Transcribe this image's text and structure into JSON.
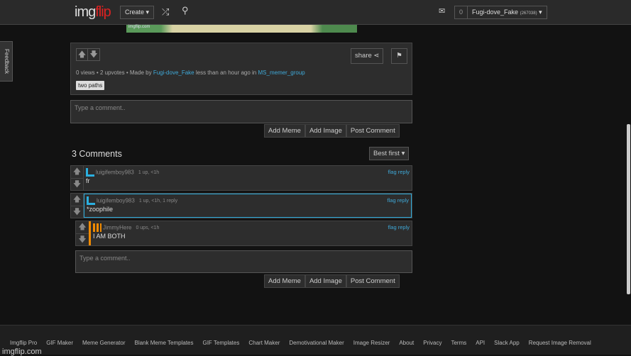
{
  "header": {
    "logo_a": "img",
    "logo_b": "flip",
    "create": "Create ▾",
    "shuffle_icon": "shuffle-icon",
    "search_icon": "search-icon",
    "mail_icon": "mail-icon",
    "notif_count": "0",
    "username": "Fugi-dove_Fake",
    "points": "(267038)",
    "caret": "▾"
  },
  "meme": {
    "watermark": "imgflip.com"
  },
  "feedback": "Feedback",
  "post": {
    "share": "share",
    "views": "0 views",
    "upvotes": "2 upvotes",
    "made_by": "Made by",
    "author": "Fugi-dove_Fake",
    "time": "less than an hour ago in",
    "group": "MS_memer_group",
    "tag": "two paths"
  },
  "comment_form": {
    "placeholder": "Type a comment..",
    "add_meme": "Add Meme",
    "add_image": "Add Image",
    "post": "Post Comment"
  },
  "comments_header": {
    "count": "3 Comments",
    "sort": "Best first ▾"
  },
  "comments": [
    {
      "user": "luigifemboy983",
      "meta": "1 up, <1h",
      "text": "fr",
      "flag": "flag",
      "reply": "reply"
    },
    {
      "user": "luigifemboy983",
      "meta": "1 up, <1h, 1 reply",
      "text": "*zoophile",
      "flag": "flag",
      "reply": "reply"
    },
    {
      "user": "JimmyHere",
      "meta": "0 ups, <1h",
      "text": "I AM BOTH",
      "flag": "flag",
      "reply": "reply"
    }
  ],
  "reply_form": {
    "placeholder": "Type a comment..",
    "add_meme": "Add Meme",
    "add_image": "Add Image",
    "post": "Post Comment"
  },
  "footer": {
    "links": [
      "Imgflip Pro",
      "GIF Maker",
      "Meme Generator",
      "Blank Meme Templates",
      "GIF Templates",
      "Chart Maker",
      "Demotivational Maker",
      "Image Resizer",
      "About",
      "Privacy",
      "Terms",
      "API",
      "Slack App",
      "Request Image Removal"
    ],
    "brand": "imgflip.com"
  }
}
